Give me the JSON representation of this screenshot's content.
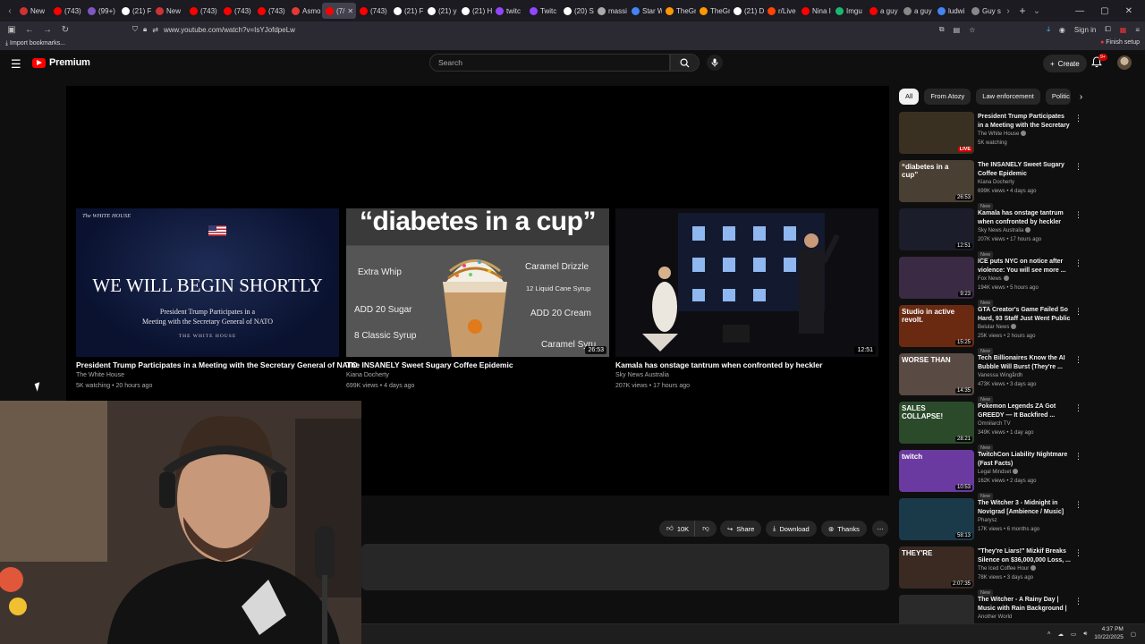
{
  "browser": {
    "tabs": [
      {
        "label": "New",
        "color": "#cc3333"
      },
      {
        "label": "(743)",
        "color": "#ff0000"
      },
      {
        "label": "(99+)",
        "color": "#7e57c2"
      },
      {
        "label": "(21) F",
        "color": "#ffffff"
      },
      {
        "label": "New",
        "color": "#cc3333"
      },
      {
        "label": "(743)",
        "color": "#ff0000"
      },
      {
        "label": "(743)",
        "color": "#ff0000"
      },
      {
        "label": "(743)",
        "color": "#ff0000"
      },
      {
        "label": "Asmo",
        "color": "#e53935"
      },
      {
        "label": "(7/",
        "color": "#ff0000",
        "active": true
      },
      {
        "label": "(743)",
        "color": "#ff0000"
      },
      {
        "label": "(21) F",
        "color": "#ffffff"
      },
      {
        "label": "(21) y",
        "color": "#ffffff"
      },
      {
        "label": "(21) H",
        "color": "#ffffff"
      },
      {
        "label": "twitc",
        "color": "#9146ff"
      },
      {
        "label": "Twitc",
        "color": "#9146ff"
      },
      {
        "label": "(20) S",
        "color": "#ffffff"
      },
      {
        "label": "massi",
        "color": "#aaaaaa"
      },
      {
        "label": "Star W",
        "color": "#4285f4"
      },
      {
        "label": "TheGr",
        "color": "#ff9800"
      },
      {
        "label": "TheGr",
        "color": "#ff9800"
      },
      {
        "label": "(21) D",
        "color": "#ffffff"
      },
      {
        "label": "r/Live",
        "color": "#ff4500"
      },
      {
        "label": "Nina I",
        "color": "#ff0000"
      },
      {
        "label": "Imgu",
        "color": "#1bb76e"
      },
      {
        "label": "a guy",
        "color": "#ff0000"
      },
      {
        "label": "a guy",
        "color": "#888888"
      },
      {
        "label": "ludwi",
        "color": "#4285f4"
      },
      {
        "label": "Guy s",
        "color": "#888888"
      }
    ],
    "url": "www.youtube.com/watch?v=IsYJofdpeLw",
    "sign_in": "Sign in",
    "import_bookmarks": "Import bookmarks...",
    "finish_setup": "Finish setup"
  },
  "header": {
    "brand": "Premium",
    "search_placeholder": "Search",
    "create_label": "Create",
    "notif_badge": "9+"
  },
  "endcards": [
    {
      "title": "President Trump Participates in a Meeting with the Secretary General of NATO",
      "channel": "The White House",
      "meta": "5K watching • 20 hours ago",
      "thumb_brand": "The WHITE HOUSE",
      "thumb_headline": "WE WILL BEGIN SHORTLY",
      "thumb_sub1": "President Trump Participates in a",
      "thumb_sub2": "Meeting with the Secretary General of NATO",
      "thumb_footer": "THE WHITE HOUSE"
    },
    {
      "title": "The INSANELY Sweet Sugary Coffee Epidemic",
      "channel": "Kiana Docherty",
      "meta": "699K views • 4 days ago",
      "duration": "26:53",
      "thumb_headline": "“diabetes in a cup”",
      "labels": [
        "Extra Whip",
        "Caramel Drizzle",
        "12 Liquid Cane Syrup",
        "ADD 20 Sugar",
        "ADD 20 Cream",
        "8 Classic Syrup",
        "Caramel Syru"
      ]
    },
    {
      "title": "Kamala has onstage tantrum when confronted by heckler",
      "channel": "Sky News Australia",
      "meta": "207K views • 17 hours ago",
      "duration": "12:51"
    }
  ],
  "actions": {
    "like_count": "10K",
    "share": "Share",
    "download": "Download",
    "thanks": "Thanks"
  },
  "chips": [
    "All",
    "From Atozy",
    "Law enforcement",
    "Politic"
  ],
  "recommendations": [
    {
      "title": "President Trump Participates in a Meeting with the Secretary ...",
      "channel": "The White House",
      "verified": true,
      "meta": "5K watching",
      "live": "LIVE",
      "bg": "#3a3022"
    },
    {
      "title": "The INSANELY Sweet Sugary Coffee Epidemic",
      "channel": "Kiana Docherty",
      "meta": "699K views • 4 days ago",
      "new": "New",
      "duration": "26:53",
      "bg": "#4a3f33",
      "overlay": "“diabetes in a cup”"
    },
    {
      "title": "Kamala has onstage tantrum when confronted by heckler",
      "channel": "Sky News Australia",
      "verified": true,
      "meta": "207K views • 17 hours ago",
      "new": "New",
      "duration": "12:51",
      "bg": "#1b1d2a"
    },
    {
      "title": "ICE puts NYC on notice after violence: You will see more ...",
      "channel": "Fox News",
      "verified": true,
      "meta": "194K views • 5 hours ago",
      "new": "New",
      "duration": "9:23",
      "bg": "#3a2a44"
    },
    {
      "title": "GTA Creator's Game Failed So Hard, 93 Staff Just Went Public",
      "channel": "Belular News",
      "verified": true,
      "meta": "25K views • 2 hours ago",
      "new": "New",
      "duration": "15:25",
      "bg": "#6a2a12",
      "overlay": "Studio in active revolt."
    },
    {
      "title": "Tech Billionaires Know the AI Bubble Will Burst (They're ...",
      "channel": "Vanessa Wingårdh",
      "meta": "473K views • 3 days ago",
      "new": "New",
      "duration": "14:35",
      "bg": "#5a4a44",
      "overlay": "WORSE THAN"
    },
    {
      "title": "Pokemon Legends ZA Got GREEDY — It Backfired ...",
      "channel": "Omnilarch TV",
      "meta": "349K views • 1 day ago",
      "new": "New",
      "duration": "28:21",
      "bg": "#2a4a2a",
      "overlay": "SALES COLLAPSE!"
    },
    {
      "title": "TwitchCon Liability Nightmare (Fast Facts)",
      "channel": "Legal Mindset",
      "verified": true,
      "meta": "162K views • 2 days ago",
      "new": "New",
      "duration": "10:53",
      "bg": "#6a3aa0",
      "overlay": "twitch"
    },
    {
      "title": "The Witcher 3 - Midnight in Novigrad [Ambience / Music]",
      "channel": "Pharysz",
      "meta": "17K views • 6 months ago",
      "duration": "58:13",
      "bg": "#1a3a4a"
    },
    {
      "title": "\"They're Liars!\" Mizkif Breaks Silence on $36,000,000 Loss, ...",
      "channel": "The Iced Coffee Hour",
      "verified": true,
      "meta": "78K views • 3 days ago",
      "new": "New",
      "duration": "2:07:35",
      "bg": "#3a2a22",
      "overlay": "THEY'RE"
    },
    {
      "title": "The Witcher - A Rainy Day | Music with Rain Background | ...",
      "channel": "Another World",
      "meta": "",
      "bg": "#2a2a2a"
    }
  ],
  "taskbar": {
    "time": "4:37 PM",
    "date": "10/22/2025"
  }
}
